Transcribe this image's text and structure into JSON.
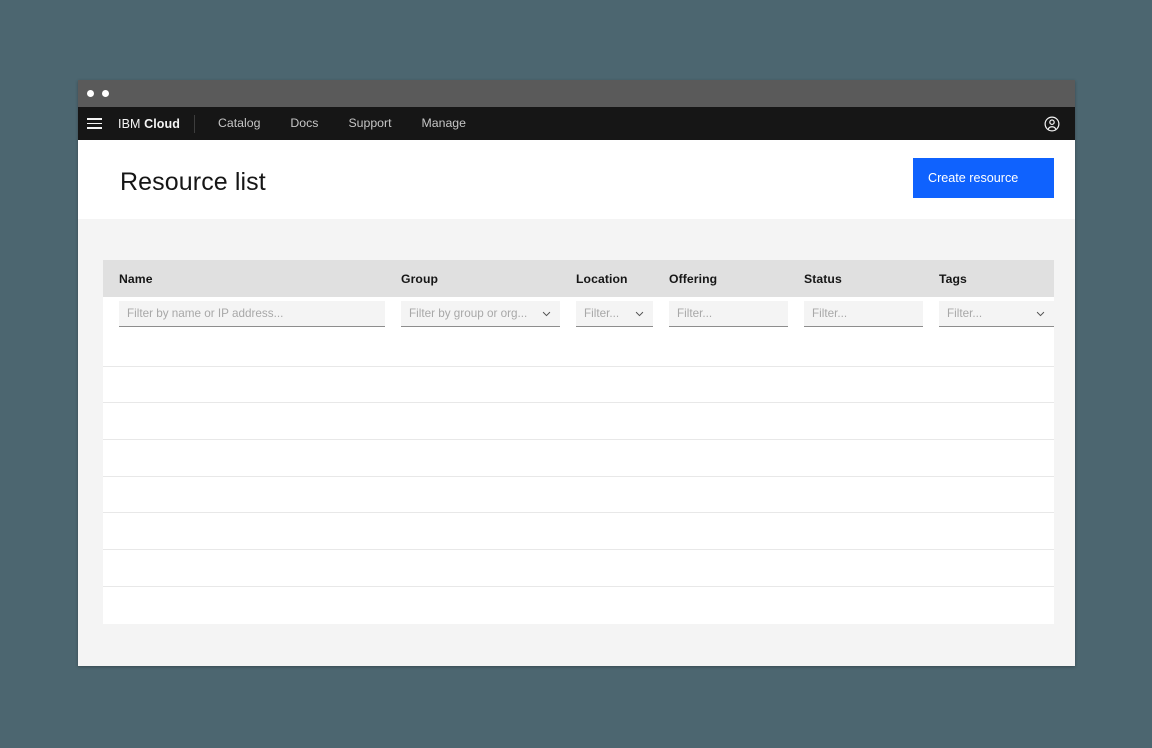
{
  "window": {
    "titlebar_dots": [
      "dot-1",
      "dot-2"
    ]
  },
  "topnav": {
    "menu_icon": "hamburger-menu-icon",
    "brand_prefix": "IBM",
    "brand_name": "Cloud",
    "links": [
      {
        "label": "Catalog"
      },
      {
        "label": "Docs"
      },
      {
        "label": "Support"
      },
      {
        "label": "Manage"
      }
    ],
    "account_icon": "user-avatar-icon",
    "background": "#161616"
  },
  "header": {
    "title": "Resource list",
    "create_button": {
      "label": "Create resource",
      "color": "#0f62fe"
    }
  },
  "table": {
    "columns": [
      {
        "header": "Name",
        "filter_placeholder": "Filter by name or IP address...",
        "type": "text"
      },
      {
        "header": "Group",
        "filter_placeholder": "Filter by group or org...",
        "type": "select"
      },
      {
        "header": "Location",
        "filter_placeholder": "Filter...",
        "type": "select"
      },
      {
        "header": "Offering",
        "filter_placeholder": "Filter...",
        "type": "text"
      },
      {
        "header": "Status",
        "filter_placeholder": "Filter...",
        "type": "text"
      },
      {
        "header": "Tags",
        "filter_placeholder": "Filter...",
        "type": "select"
      }
    ],
    "rows": [
      {},
      {},
      {},
      {},
      {},
      {},
      {},
      {}
    ],
    "header_background": "#e0e0e0",
    "row_count": 8
  },
  "colors": {
    "desktop_background": "#4c6670",
    "titlebar": "#5a5a5a",
    "page_background": "#f4f4f4",
    "accent": "#0f62fe"
  }
}
